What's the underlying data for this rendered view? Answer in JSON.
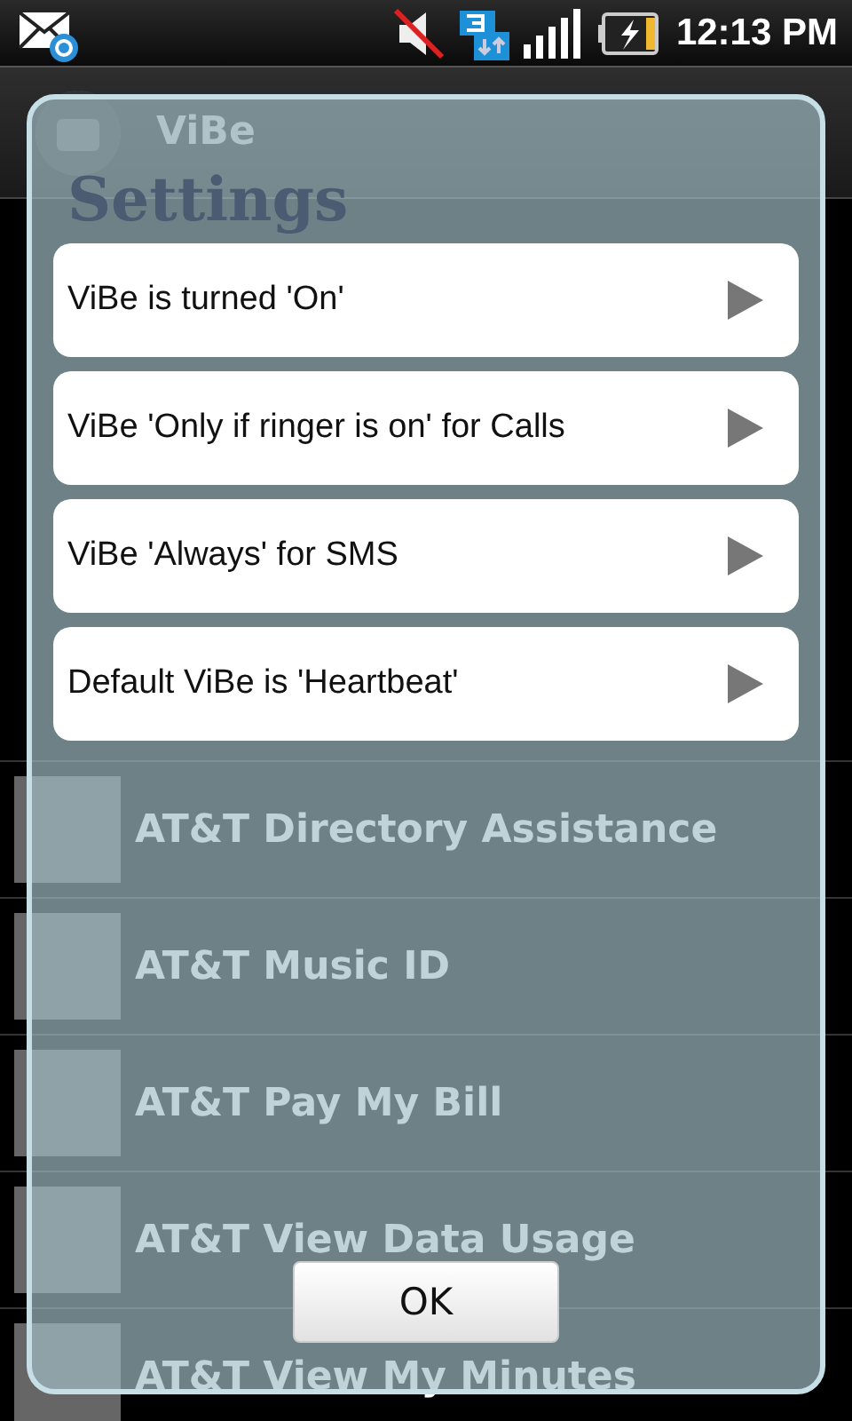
{
  "status_bar": {
    "time": "12:13 PM"
  },
  "app": {
    "title": "ViBe"
  },
  "background_list": [
    {
      "label": "AT&T Directory Assistance"
    },
    {
      "label": "AT&T Music ID"
    },
    {
      "label": "AT&T Pay My Bill"
    },
    {
      "label": "AT&T View Data Usage"
    },
    {
      "label": "AT&T View My Minutes"
    }
  ],
  "dialog": {
    "title": "Settings",
    "settings": [
      {
        "label": "ViBe is turned 'On'"
      },
      {
        "label": "ViBe 'Only if ringer is on' for Calls"
      },
      {
        "label": "ViBe 'Always' for SMS"
      },
      {
        "label": "Default ViBe is 'Heartbeat'"
      }
    ],
    "button": "OK"
  }
}
